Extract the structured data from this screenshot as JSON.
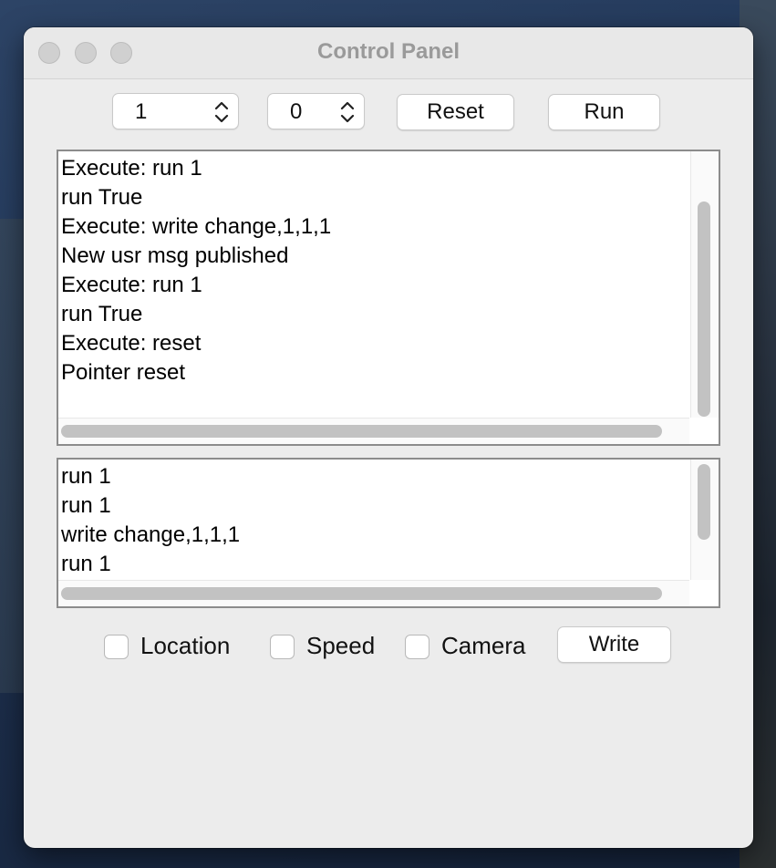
{
  "window": {
    "title": "Control Panel"
  },
  "controls": {
    "spinner1_value": "1",
    "spinner2_value": "0",
    "reset_label": "Reset",
    "run_label": "Run"
  },
  "output_log": {
    "lines": [
      "Execute: run 1",
      "run True",
      "Execute: write change,1,1,1",
      "New usr msg published",
      "Execute: run 1",
      "run True",
      "Execute: reset",
      "Pointer reset"
    ]
  },
  "command_history": {
    "lines": [
      "run 1",
      "run 1",
      "write change,1,1,1",
      "run 1"
    ]
  },
  "options": {
    "location_label": "Location",
    "speed_label": "Speed",
    "camera_label": "Camera",
    "location_checked": false,
    "speed_checked": false,
    "camera_checked": false,
    "write_label": "Write"
  }
}
